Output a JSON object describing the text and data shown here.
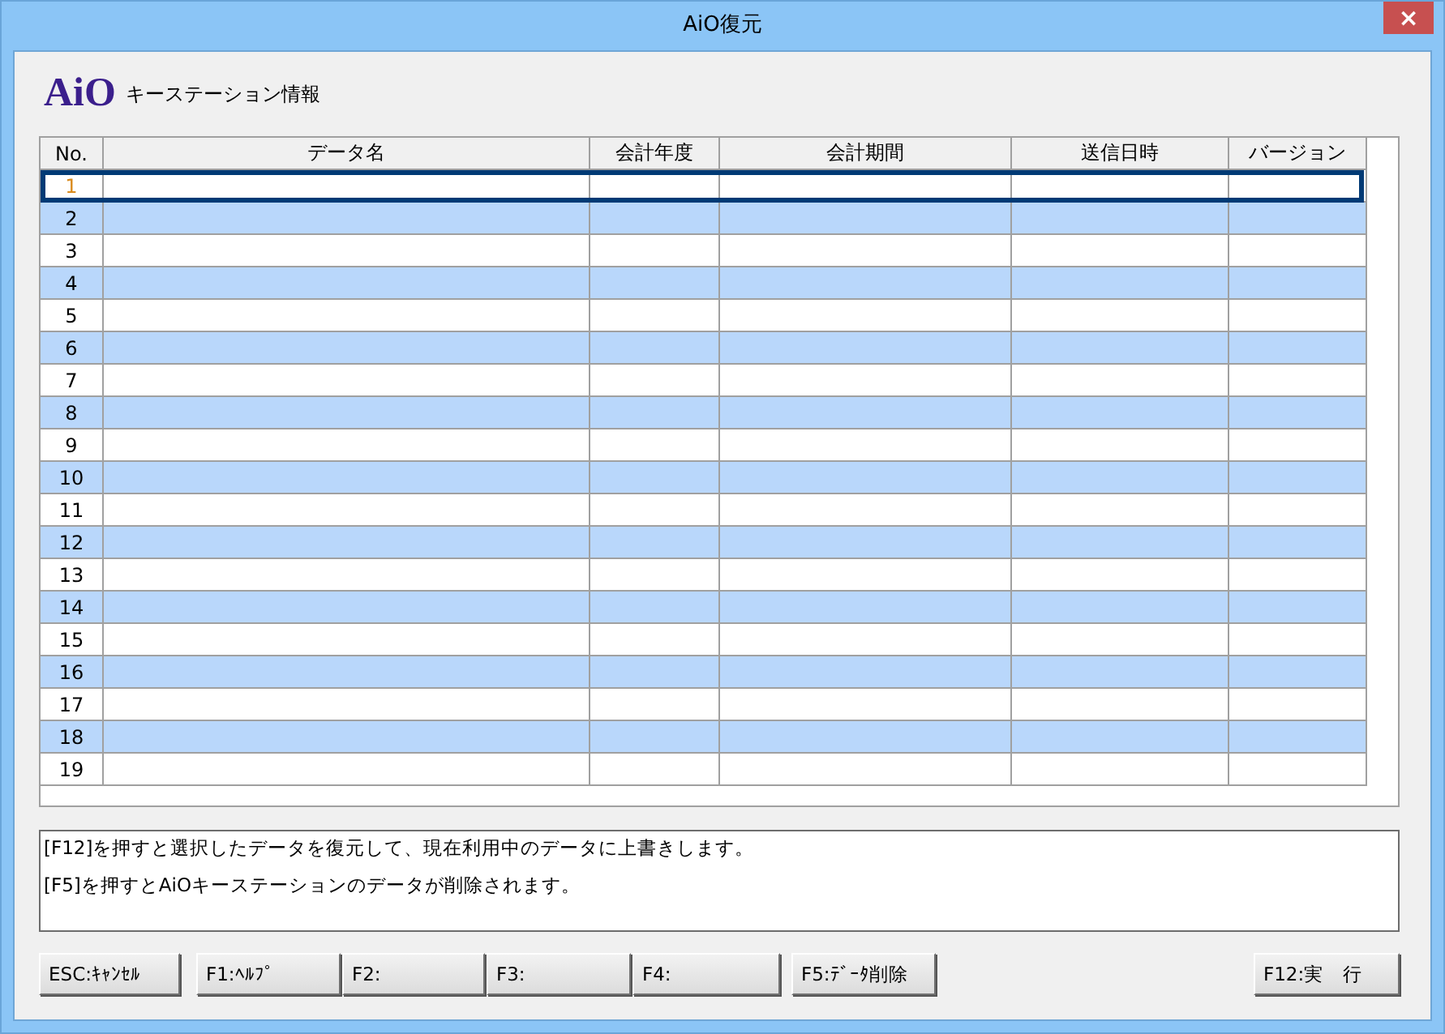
{
  "window": {
    "title": "AiO復元",
    "close": "×"
  },
  "header": {
    "logo": "AiO",
    "title": "キーステーション情報"
  },
  "table": {
    "columns": [
      "No.",
      "データ名",
      "会計年度",
      "会計期間",
      "送信日時",
      "バージョン"
    ],
    "rows": [
      {
        "no": "1",
        "selected": true
      },
      {
        "no": "2",
        "selected": false
      },
      {
        "no": "3",
        "selected": false
      },
      {
        "no": "4",
        "selected": false
      },
      {
        "no": "5",
        "selected": false
      },
      {
        "no": "6",
        "selected": false
      },
      {
        "no": "7",
        "selected": false
      },
      {
        "no": "8",
        "selected": false
      },
      {
        "no": "9",
        "selected": false
      },
      {
        "no": "10",
        "selected": false
      },
      {
        "no": "11",
        "selected": false
      },
      {
        "no": "12",
        "selected": false
      },
      {
        "no": "13",
        "selected": false
      },
      {
        "no": "14",
        "selected": false
      },
      {
        "no": "15",
        "selected": false
      },
      {
        "no": "16",
        "selected": false
      },
      {
        "no": "17",
        "selected": false
      },
      {
        "no": "18",
        "selected": false
      },
      {
        "no": "19",
        "selected": false
      }
    ]
  },
  "messages": [
    "[F12]を押すと選択したデータを復元して、現在利用中のデータに上書きします。",
    "[F5]を押すとAiOキーステーションのデータが削除されます。"
  ],
  "buttons_left": [
    "ESC:ｷｬﾝｾﾙ",
    "F1:ﾍﾙﾌﾟ",
    "F2:",
    "F3:",
    "F4:",
    "F5:ﾃﾞｰﾀ削除"
  ],
  "buttons_right": [
    "F12:実　行"
  ]
}
